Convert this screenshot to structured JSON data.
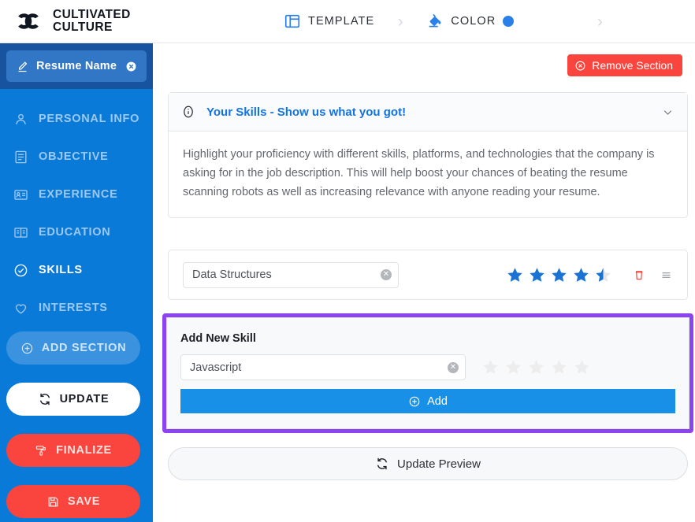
{
  "brand": {
    "name_line1": "CULTIVATED",
    "name_line2": "CULTURE",
    "logo_icon": "interlocking-c-logo"
  },
  "header": {
    "steps": [
      {
        "label": "TEMPLATE",
        "icon": "layout-template-icon"
      },
      {
        "label": "COLOR",
        "icon": "paint-bucket-icon",
        "swatch": "#2a7fe8"
      }
    ],
    "separator_icon": "chevron-right-icon"
  },
  "sidebar": {
    "resume_name": {
      "label": "Resume Name",
      "edit_icon": "pencil-icon",
      "clear_icon": "circle-x-icon"
    },
    "items": [
      {
        "label": "PERSONAL INFO",
        "icon": "user-icon",
        "active": false
      },
      {
        "label": "OBJECTIVE",
        "icon": "document-text-icon",
        "active": false
      },
      {
        "label": "EXPERIENCE",
        "icon": "id-card-icon",
        "active": false
      },
      {
        "label": "EDUCATION",
        "icon": "book-icon",
        "active": false
      },
      {
        "label": "SKILLS",
        "icon": "check-circle-icon",
        "active": true
      },
      {
        "label": "INTERESTS",
        "icon": "heart-icon",
        "active": false
      }
    ],
    "buttons": [
      {
        "label": "ADD SECTION",
        "icon": "plus-circle-icon",
        "color": "#3b92de"
      },
      {
        "label": "UPDATE",
        "icon": "refresh-icon",
        "color": "#ffffff"
      },
      {
        "label": "FINALIZE",
        "icon": "paint-roller-icon",
        "color": "#f9453e"
      },
      {
        "label": "SAVE",
        "icon": "floppy-disk-icon",
        "color": "#f9453e"
      }
    ]
  },
  "main": {
    "remove_section": {
      "label": "Remove Section",
      "icon": "circle-x-icon",
      "color": "#f9453e"
    },
    "info_panel": {
      "icon": "info-circle-icon",
      "title": "Your Skills - Show us what you got!",
      "collapse_icon": "chevron-down-icon",
      "body": "Highlight your proficiency with different skills, platforms, and technologies that the company is asking for in the job description. This will help boost your chances of beating the resume scanning robots as well as increasing relevance with anyone reading your resume."
    },
    "skill_rows": [
      {
        "value": "Data Structures",
        "placeholder": "Skill",
        "rating": 4.5,
        "max_rating": 5,
        "clear_icon": "circle-x-icon",
        "delete_icon": "trash-icon",
        "drag_icon": "drag-handle-icon"
      }
    ],
    "add_skill": {
      "title": "Add New Skill",
      "value": "Javascript",
      "placeholder": "Skill",
      "clear_icon": "circle-x-icon",
      "rating": 0,
      "max_rating": 5,
      "add_button": {
        "label": "Add",
        "icon": "plus-circle-icon",
        "color": "#1890e8"
      },
      "highlight_color": "#8b44f0"
    },
    "update_preview": {
      "label": "Update Preview",
      "icon": "refresh-icon"
    }
  }
}
